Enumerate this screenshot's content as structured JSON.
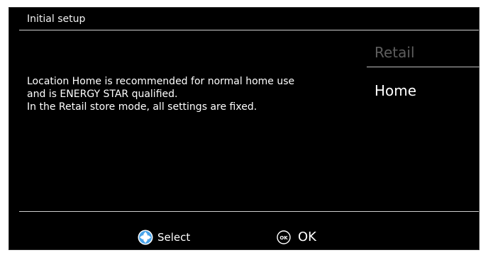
{
  "window": {
    "title": "Initial setup"
  },
  "description": {
    "lines": [
      "Location Home is recommended for normal home use",
      "and is ENERGY STAR qualified.",
      "In the Retail store mode, all settings are fixed."
    ]
  },
  "options": [
    {
      "label": "Retail",
      "state": "unselected"
    },
    {
      "label": "Home",
      "state": "selected"
    }
  ],
  "footer": {
    "select_label": "Select",
    "ok_label": "OK",
    "ok_icon_text": "OK"
  },
  "colors": {
    "background": "#000000",
    "text": "#ffffff",
    "dim_option": "#5e5e5e",
    "dpad_blue": "#4aa3e8"
  },
  "icons": {
    "select": "dpad-icon",
    "ok": "ok-button-icon"
  }
}
